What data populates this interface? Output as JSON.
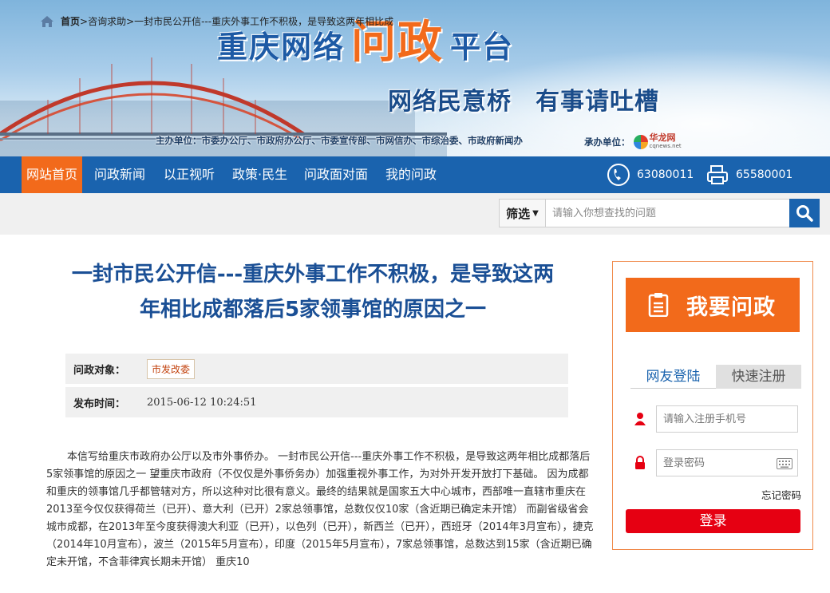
{
  "banner": {
    "title_part1": "重庆网络",
    "title_part2": "问政",
    "title_part3": "平台",
    "slogan_left": "网络民意桥",
    "slogan_right": "有事请吐槽",
    "hosts": "主办单位：市委办公厅、市政府办公厅、市委宣传部、市网信办、市综治委、市政府新闻办",
    "co_label": "承办单位：",
    "co_logo_name": "华龙网",
    "co_logo_sub": "cqnews.net"
  },
  "nav": {
    "items": [
      "网站首页",
      "问政新闻",
      "以正视听",
      "政策·民生",
      "问政面对面",
      "我的问政"
    ],
    "phone": "63080011",
    "fax": "65580001"
  },
  "breadcrumb": {
    "first": "首页",
    "rest": ">咨询求助>一封市民公开信---重庆外事工作不积极，是导致这两年相比成"
  },
  "search": {
    "filter_label": "筛选",
    "placeholder": "请输入你想查找的问题"
  },
  "article": {
    "title_line1": "一封市民公开信---重庆外事工作不积极，是导致这两",
    "title_line2": "年相比成都落后5家领事馆的原因之一",
    "target_label": "问政对象：",
    "target_value": "市发改委",
    "time_label": "发布时间：",
    "time_value": "2015-06-12 10:24:51",
    "body": "本信写给重庆市政府办公厅以及市外事侨办。 一封市民公开信---重庆外事工作不积极，是导致这两年相比成都落后5家领事馆的原因之一 望重庆市政府（不仅仅是外事侨务办）加强重视外事工作，为对外开发开放打下基础。 因为成都和重庆的领事馆几乎都管辖对方，所以这种对比很有意义。最终的结果就是国家五大中心城市，西部唯一直辖市重庆在2013至今仅仅获得荷兰（已开）、意大利（已开）2家总领事馆，总数仅仅10家（含近期已确定未开馆） 而副省级省会城市成都，在2013年至今度获得澳大利亚（已开），以色列（已开），新西兰（已开），西班牙（2014年3月宣布），捷克（2014年10月宣布），波兰（2015年5月宣布），印度（2015年5月宣布），7家总领事馆，总数达到15家（含近期已确定未开馆，不含菲律宾长期未开馆） 重庆10"
  },
  "side": {
    "ask_label": "我要问政",
    "tab_login": "网友登陆",
    "tab_register": "快速注册",
    "phone_placeholder": "请输入注册手机号",
    "password_placeholder": "登录密码",
    "forgot_label": "忘记密码",
    "login_label": "登录"
  },
  "colors": {
    "nav_blue": "#1a63ae",
    "accent_orange": "#f26a1b",
    "title_blue": "#1a4f95",
    "login_red": "#e60012"
  }
}
